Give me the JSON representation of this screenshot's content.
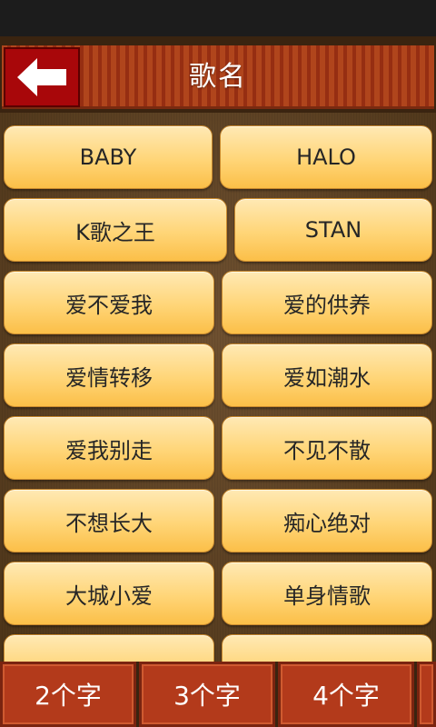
{
  "header": {
    "title": "歌名",
    "back_icon": "arrow-left-icon"
  },
  "songs": [
    [
      "BABY",
      "HALO"
    ],
    [
      "K歌之王",
      "STAN"
    ],
    [
      "爱不爱我",
      "爱的供养"
    ],
    [
      "爱情转移",
      "爱如潮水"
    ],
    [
      "爱我别走",
      "不见不散"
    ],
    [
      "不想长大",
      "痴心绝对"
    ],
    [
      "大城小爱",
      "单身情歌"
    ],
    [
      "",
      ""
    ]
  ],
  "tabs": [
    "2个字",
    "3个字",
    "4个字",
    ""
  ],
  "colors": {
    "header_red": "#b0451c",
    "back_button": "#a8070a",
    "button_yellow": "#ffd577",
    "tab_red": "#b33a1b"
  }
}
